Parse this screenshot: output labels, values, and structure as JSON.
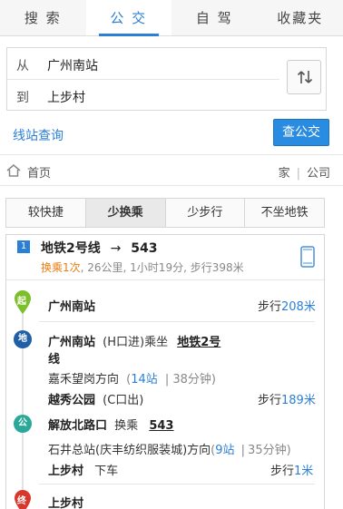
{
  "tabs": [
    "搜 索",
    "公 交",
    "自 驾",
    "收藏夹"
  ],
  "route": {
    "from_label": "从",
    "from_value": "广州南站",
    "to_label": "到",
    "to_value": "上步村"
  },
  "links": {
    "line_query": "线站查询",
    "query_button": "查公交"
  },
  "home": {
    "label": "首页",
    "home": "家",
    "company": "公司",
    "divider": "|"
  },
  "filters": [
    "较快捷",
    "少换乘",
    "少步行",
    "不坐地铁"
  ],
  "plan": {
    "number": "1",
    "title": "地铁2号线",
    "arrow": "→",
    "bus": "543",
    "transfer": "换乘1次",
    "meta": ", 26公里, 1小时19分, 步行398米"
  },
  "steps": {
    "start": {
      "icon": "起",
      "station": "广州南站",
      "walk_label": "步行",
      "walk_distance": "208米"
    },
    "metro": {
      "icon": "地",
      "station": "广州南站",
      "exit": "(H口进)乘坐",
      "line_part1": "地铁2号",
      "line_part2": "线",
      "direction": "嘉禾望岗方向",
      "stops": "14站",
      "sep": "|",
      "duration": "38分钟",
      "paren_open": "(",
      "paren_close": ")",
      "alight_station": "越秀公园",
      "alight_exit": "(C口出)",
      "walk_label": "步行",
      "walk_distance": "189米"
    },
    "bus": {
      "icon": "公",
      "station": "解放北路口",
      "transfer_label": "换乘",
      "bus_no": "543",
      "direction": "石井总站(庆丰纺织服装城)方向",
      "stops": "9站",
      "sep": "|",
      "duration": "35分钟",
      "paren_open": "(",
      "paren_close": ")",
      "alight_station": "上步村",
      "alight_action": "下车",
      "walk_label": "步行",
      "walk_distance": "1米"
    },
    "end": {
      "icon": "终",
      "station": "上步村"
    }
  },
  "colors": {
    "accent": "#2c7fd6",
    "orange": "#e97d13",
    "start_green": "#7bbf2a",
    "metro_blue": "#1f5fa8",
    "bus_teal": "#2aa89a",
    "end_red": "#d9372b"
  },
  "icons": [
    "swap-icon",
    "home-icon",
    "phone-icon",
    "start-marker-icon",
    "metro-icon",
    "bus-icon",
    "end-marker-icon"
  ]
}
